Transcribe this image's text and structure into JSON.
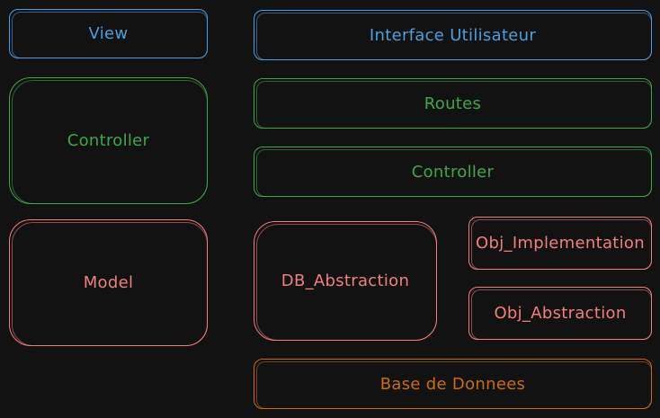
{
  "colors": {
    "background": "#121212",
    "view_layer": "#4a9fe0",
    "controller_layer": "#3fa64a",
    "model_layer": "#f07f7f",
    "database_layer": "#c96c10"
  },
  "left_column": {
    "view": "View",
    "controller": "Controller",
    "model": "Model"
  },
  "right_column": {
    "interface": "Interface Utilisateur",
    "routes": "Routes",
    "controller": "Controller",
    "db_abstraction": "DB_Abstraction",
    "obj_implementation": "Obj_Implementation",
    "obj_abstraction": "Obj_Abstraction",
    "database": "Base de Donnees"
  }
}
